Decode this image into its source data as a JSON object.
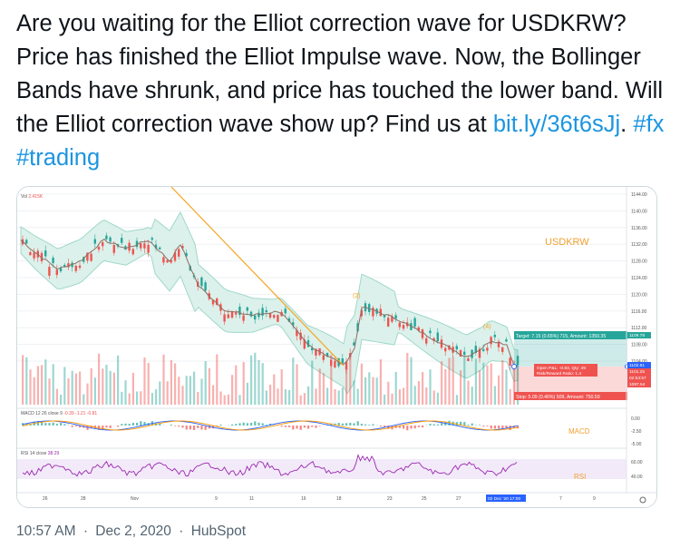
{
  "tweet": {
    "text_before_link": "Are you waiting for the Elliot correction wave for USDKRW? Price has finished the Elliot Impulse wave. Now, the Bollinger Bands have shrunk, and price has touched the lower band. Will the Elliot correction wave show up? Find us at ",
    "link": "bit.ly/36t6sJj",
    "after_link": ". ",
    "hashtag1": "#fx",
    "hashtag2": "#trading",
    "time": "10:57 AM",
    "sep": "·",
    "date": "Dec 2, 2020",
    "source": "HubSpot"
  },
  "chart": {
    "symbol_label": "USDKRW",
    "vol_label": "Vol",
    "vol_value": "2.415K",
    "macd_label": "MACD 12 26 close 9",
    "macd_vals": "-0.39   -1.21   -0.81",
    "macd_panel_label": "MACD",
    "rsi_label": "RSI 14 close",
    "rsi_val": "38.29",
    "rsi_panel_label": "RSI",
    "wave_labels": [
      "(2)",
      "(4)"
    ],
    "target_text": "Target: 7.15 (0.65%) 715, Amount: 1350.35",
    "position_text_1": "Open P&L: -0.93, Qty: 49",
    "position_text_2": "Risk/Reward Ratio: 1.4",
    "stop_text": "Stop: 5.09 (0.46%) 509, Amount: 750.59",
    "y_ticks": [
      "1144.00",
      "1140.00",
      "1136.00",
      "1132.00",
      "1128.00",
      "1124.00",
      "1120.00",
      "1116.00",
      "1112.00",
      "1108.00",
      "1104.00"
    ],
    "price_tags": [
      "1109.78",
      "1102.61",
      "1101.25",
      "02:53:57",
      "1097.54"
    ],
    "macd_ticks": [
      "0.00",
      "-2.50",
      "-5.00"
    ],
    "rsi_ticks": [
      "60.00",
      "40.00"
    ],
    "x_ticks": [
      "26",
      "28",
      "Nov",
      "9",
      "11",
      "16",
      "18",
      "23",
      "25",
      "27",
      "Dec",
      "7",
      "9"
    ],
    "x_highlight": "02 Dec '20   17:00",
    "colors": {
      "up": "#26a69a",
      "down": "#ef5350",
      "band": "#9fd8c9",
      "accent": "#f5a623",
      "rsi": "#9c27b0",
      "macd": "#2962ff",
      "signal": "#ff9800"
    }
  }
}
